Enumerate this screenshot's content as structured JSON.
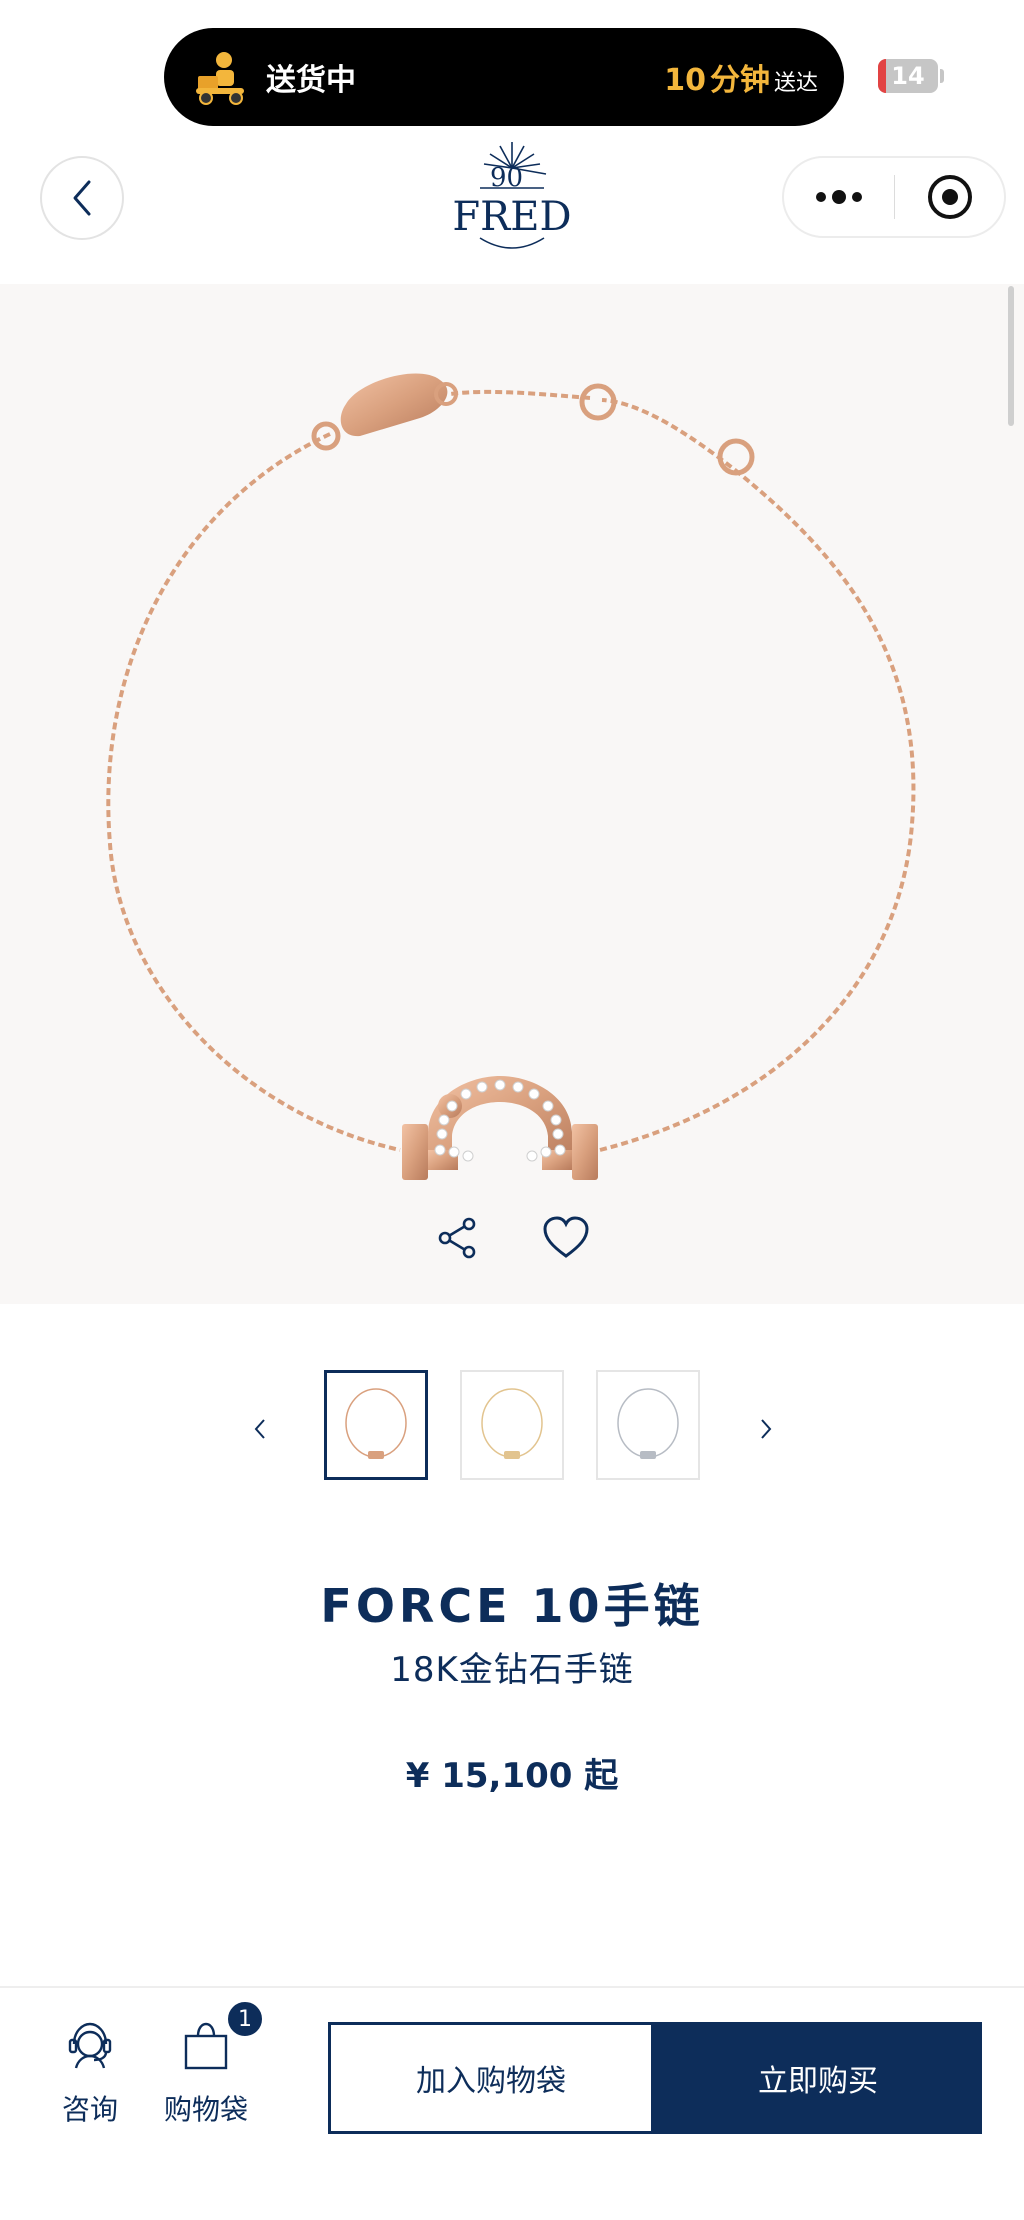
{
  "status": {
    "delivery_text": "送货中",
    "eta_number": "10",
    "eta_unit": "分钟",
    "eta_suffix": "送达",
    "battery_level": "14",
    "battery_fraction": 0.14
  },
  "header": {
    "logo_text": "FRED",
    "logo_anniversary": "90"
  },
  "product": {
    "title": "FORCE 10手链",
    "subtitle": "18K金钻石手链",
    "price": "¥ 15,100 起",
    "thumbnails": [
      {
        "variant": "rose-gold",
        "selected": true
      },
      {
        "variant": "yellow-gold",
        "selected": false
      },
      {
        "variant": "white-gold",
        "selected": false
      }
    ]
  },
  "bottom_bar": {
    "consult_label": "咨询",
    "bag_label": "购物袋",
    "bag_count": "1",
    "add_to_bag_label": "加入购物袋",
    "buy_now_label": "立即购买"
  },
  "colors": {
    "brand_navy": "#0d2d5a",
    "rose_gold": "#d9a07e",
    "eta_yellow": "#f3b63c",
    "battery_red": "#e24343"
  }
}
